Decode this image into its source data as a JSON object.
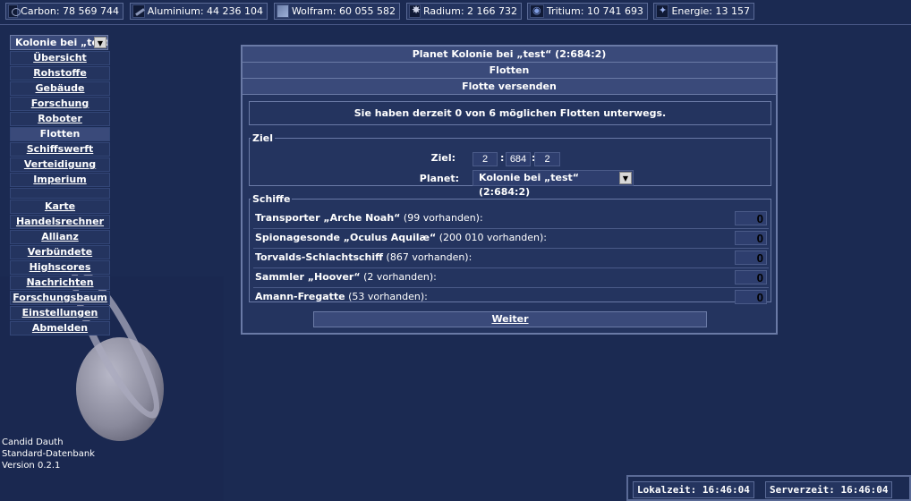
{
  "resources": [
    {
      "icon": "carbon-icon",
      "label": "Carbon",
      "value": "78 569 744"
    },
    {
      "icon": "aluminium-icon",
      "label": "Aluminium",
      "value": "44 236 104"
    },
    {
      "icon": "wolfram-icon",
      "label": "Wolfram",
      "value": "60 055 582"
    },
    {
      "icon": "radium-icon",
      "label": "Radium",
      "value": "2 166 732"
    },
    {
      "icon": "tritium-icon",
      "label": "Tritium",
      "value": "10 741 693"
    },
    {
      "icon": "energie-icon",
      "label": "Energie",
      "value": "13 157"
    }
  ],
  "sidebar": {
    "planet_select": "Kolonie bei „test“",
    "items": [
      {
        "label": "Übersicht"
      },
      {
        "label": "Rohstoffe"
      },
      {
        "label": "Gebäude"
      },
      {
        "label": "Forschung"
      },
      {
        "label": "Roboter"
      },
      {
        "label": "Flotten"
      },
      {
        "label": "Schiffswerft"
      },
      {
        "label": "Verteidigung"
      },
      {
        "label": "Imperium"
      }
    ],
    "items2": [
      {
        "label": "Karte"
      },
      {
        "label": "Handelsrechner"
      },
      {
        "label": "Allianz"
      },
      {
        "label": "Verbündete"
      },
      {
        "label": "Highscores"
      },
      {
        "label": "Nachrichten"
      },
      {
        "label": "Forschungsbaum"
      },
      {
        "label": "Einstellungen"
      },
      {
        "label": "Abmelden"
      }
    ]
  },
  "footer": {
    "user": "Candid Dauth",
    "database": "Standard-Datenbank",
    "version": "Version 0.2.1"
  },
  "panel": {
    "title": "Planet Kolonie bei „test“ (2:684:2)",
    "section": "Flotten",
    "subsection": "Flotte versenden",
    "info": "Sie haben derzeit 0 von 6 möglichen Flotten unterwegs.",
    "ziel": {
      "legend": "Ziel",
      "ziel_label": "Ziel:",
      "galaxy": "2",
      "system": "684",
      "planet": "2",
      "planet_label": "Planet:",
      "planet_value": "Kolonie bei „test“ (2:684:2)"
    },
    "schiffe": {
      "legend": "Schiffe",
      "ships": [
        {
          "name": "Transporter „Arche Noah“",
          "count": " (99 vorhanden):",
          "qty": "0"
        },
        {
          "name": "Spionagesonde „Oculus Aquilæ“",
          "count": " (200 010 vorhanden):",
          "qty": "0"
        },
        {
          "name": "Torvalds-Schlachtschiff",
          "count": " (867 vorhanden):",
          "qty": "0"
        },
        {
          "name": "Sammler „Hoover“",
          "count": " (2 vorhanden):",
          "qty": "0"
        },
        {
          "name": "Amann-Fregatte",
          "count": " (53 vorhanden):",
          "qty": "0"
        }
      ]
    },
    "weiter": "Weiter"
  },
  "clocks": {
    "local": "Lokalzeit: 16:46:04",
    "server": "Serverzeit: 16:46:04"
  }
}
